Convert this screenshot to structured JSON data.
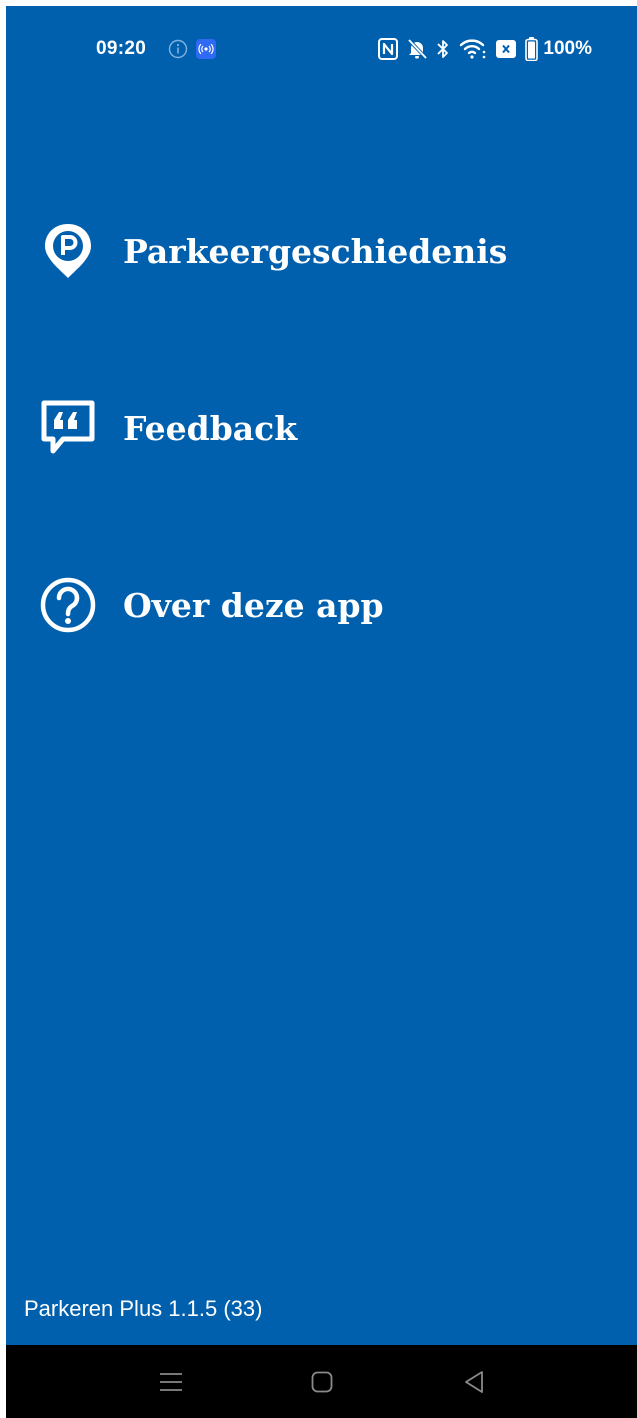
{
  "status_bar": {
    "time": "09:20",
    "battery_percent": "100%",
    "left_icons": [
      "info-icon",
      "broadcast-icon"
    ],
    "right_icons": [
      "nfc-icon",
      "bell-off-icon",
      "bluetooth-icon",
      "wifi-icon",
      "sim-off-icon",
      "battery-icon"
    ]
  },
  "menu": {
    "items": [
      {
        "label": "Parkeergeschiedenis",
        "icon": "parking-pin-icon"
      },
      {
        "label": "Feedback",
        "icon": "quote-bubble-icon"
      },
      {
        "label": "Over deze app",
        "icon": "help-circle-icon"
      }
    ]
  },
  "footer": {
    "version": "Parkeren Plus 1.1.5 (33)"
  },
  "nav_bar": {
    "buttons": [
      "menu-icon",
      "home-icon",
      "back-icon"
    ]
  },
  "colors": {
    "background": "#0160ad",
    "text": "#ffffff",
    "nav_bar": "#000000",
    "broadcast_badge": "#2f6af5"
  }
}
